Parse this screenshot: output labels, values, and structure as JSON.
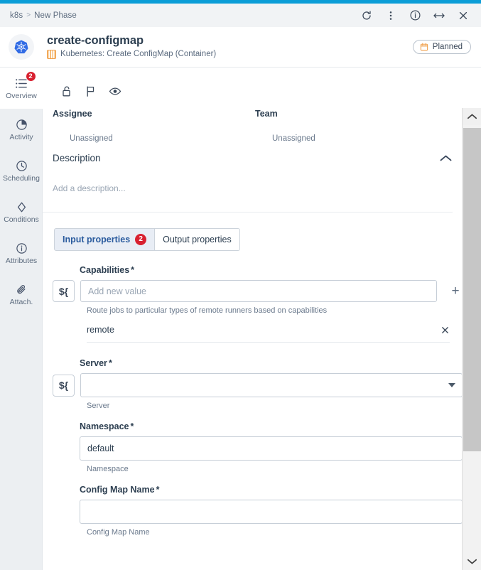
{
  "theme": {
    "accent_bar": "#0b9dd7",
    "badge_red": "#d8202f",
    "tab_active_blue": "#2a5b9e",
    "kubernetes_blue": "#326ce5",
    "type_icon_orange": "#f0a04b"
  },
  "window": {
    "breadcrumb": {
      "root": "k8s",
      "separator": ">",
      "current": "New Phase"
    },
    "actions": [
      {
        "name": "refresh-button",
        "icon": "refresh-icon"
      },
      {
        "name": "more-options-button",
        "icon": "more-vertical-icon"
      },
      {
        "name": "info-button",
        "icon": "info-circle-icon"
      },
      {
        "name": "expand-width-button",
        "icon": "arrows-horizontal-icon"
      },
      {
        "name": "close-button",
        "icon": "close-icon"
      }
    ]
  },
  "header": {
    "avatar_icon": "kubernetes-logo-icon",
    "title": "create-configmap",
    "subtitle": "Kubernetes: Create ConfigMap (Container)",
    "subtitle_icon": "task-type-icon",
    "status": {
      "label": "Planned",
      "icon": "calendar-icon"
    }
  },
  "sidebar": {
    "items": [
      {
        "label": "Overview",
        "icon": "list-icon",
        "badge": "2",
        "active": true
      },
      {
        "label": "Activity",
        "icon": "pie-chart-icon",
        "badge": "",
        "active": false
      },
      {
        "label": "Scheduling",
        "icon": "clock-icon",
        "badge": "",
        "active": false
      },
      {
        "label": "Conditions",
        "icon": "diamond-icon",
        "badge": "",
        "active": false
      },
      {
        "label": "Attributes",
        "icon": "info-circle-icon",
        "badge": "",
        "active": false
      },
      {
        "label": "Attach.",
        "icon": "paperclip-icon",
        "badge": "",
        "active": false
      }
    ]
  },
  "main": {
    "icon_row": [
      {
        "name": "lock-open-button",
        "icon": "lock-open-icon"
      },
      {
        "name": "flag-button",
        "icon": "flag-icon"
      },
      {
        "name": "watch-button",
        "icon": "eye-icon"
      }
    ],
    "assignee": {
      "label": "Assignee",
      "value": "Unassigned"
    },
    "team": {
      "label": "Team",
      "value": "Unassigned"
    },
    "description": {
      "title": "Description",
      "placeholder": "Add a description...",
      "collapse_icon": "chevron-up-icon"
    },
    "tabs": [
      {
        "label": "Input properties",
        "badge": "2",
        "active": true
      },
      {
        "label": "Output properties",
        "badge": "",
        "active": false
      }
    ],
    "fields": {
      "capabilities": {
        "label": "Capabilities",
        "required": "*",
        "expression_button": "${",
        "placeholder": "Add new value",
        "value": "",
        "add_button": "+",
        "help": "Route jobs to particular types of remote runners based on capabilities",
        "chips": [
          {
            "text": "remote",
            "remove_icon": "close-icon"
          }
        ]
      },
      "server": {
        "label": "Server",
        "required": "*",
        "expression_button": "${",
        "value": "",
        "placeholder": "",
        "help": "Server",
        "caret_icon": "chevron-down-icon"
      },
      "namespace": {
        "label": "Namespace",
        "required": "*",
        "value": "default",
        "placeholder": "",
        "help": "Namespace"
      },
      "config_map_name": {
        "label": "Config Map Name",
        "required": "*",
        "value": "",
        "placeholder": "",
        "help": "Config Map Name"
      }
    }
  },
  "scrollbar": {
    "up_icon": "chevron-up-icon",
    "down_icon": "chevron-down-icon"
  }
}
